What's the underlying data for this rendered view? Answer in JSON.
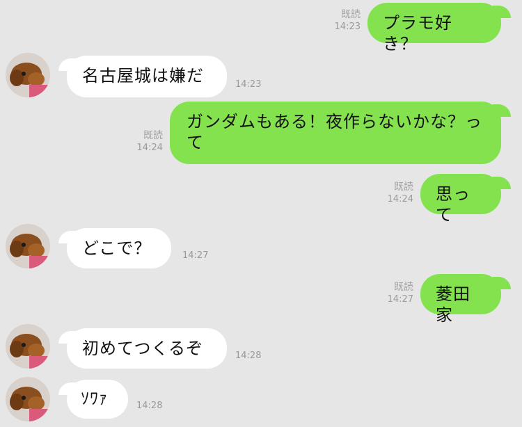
{
  "messages": [
    {
      "dir": "out",
      "text": "プラモ好き？",
      "read": "既読",
      "time": "14:23"
    },
    {
      "dir": "in",
      "text": "名古屋城は嫌だ",
      "time": "14:23"
    },
    {
      "dir": "out",
      "text": "ガンダムもある！夜作らないかな？って",
      "read": "既読",
      "time": "14:24"
    },
    {
      "dir": "out",
      "text": "思って",
      "read": "既読",
      "time": "14:24"
    },
    {
      "dir": "in",
      "text": "どこで？",
      "time": "14:27"
    },
    {
      "dir": "out",
      "text": "菱田家",
      "read": "既読",
      "time": "14:27"
    },
    {
      "dir": "in",
      "text": "初めてつくるぞ",
      "time": "14:28"
    },
    {
      "dir": "in",
      "text": "ｿﾜｧ",
      "time": "14:28"
    }
  ],
  "icons": {
    "avatar": "dog-avatar-icon"
  },
  "colors": {
    "background": "#e6e6e6",
    "outgoing": "#84e24f",
    "incoming": "#ffffff",
    "meta": "#9a9a9a"
  }
}
